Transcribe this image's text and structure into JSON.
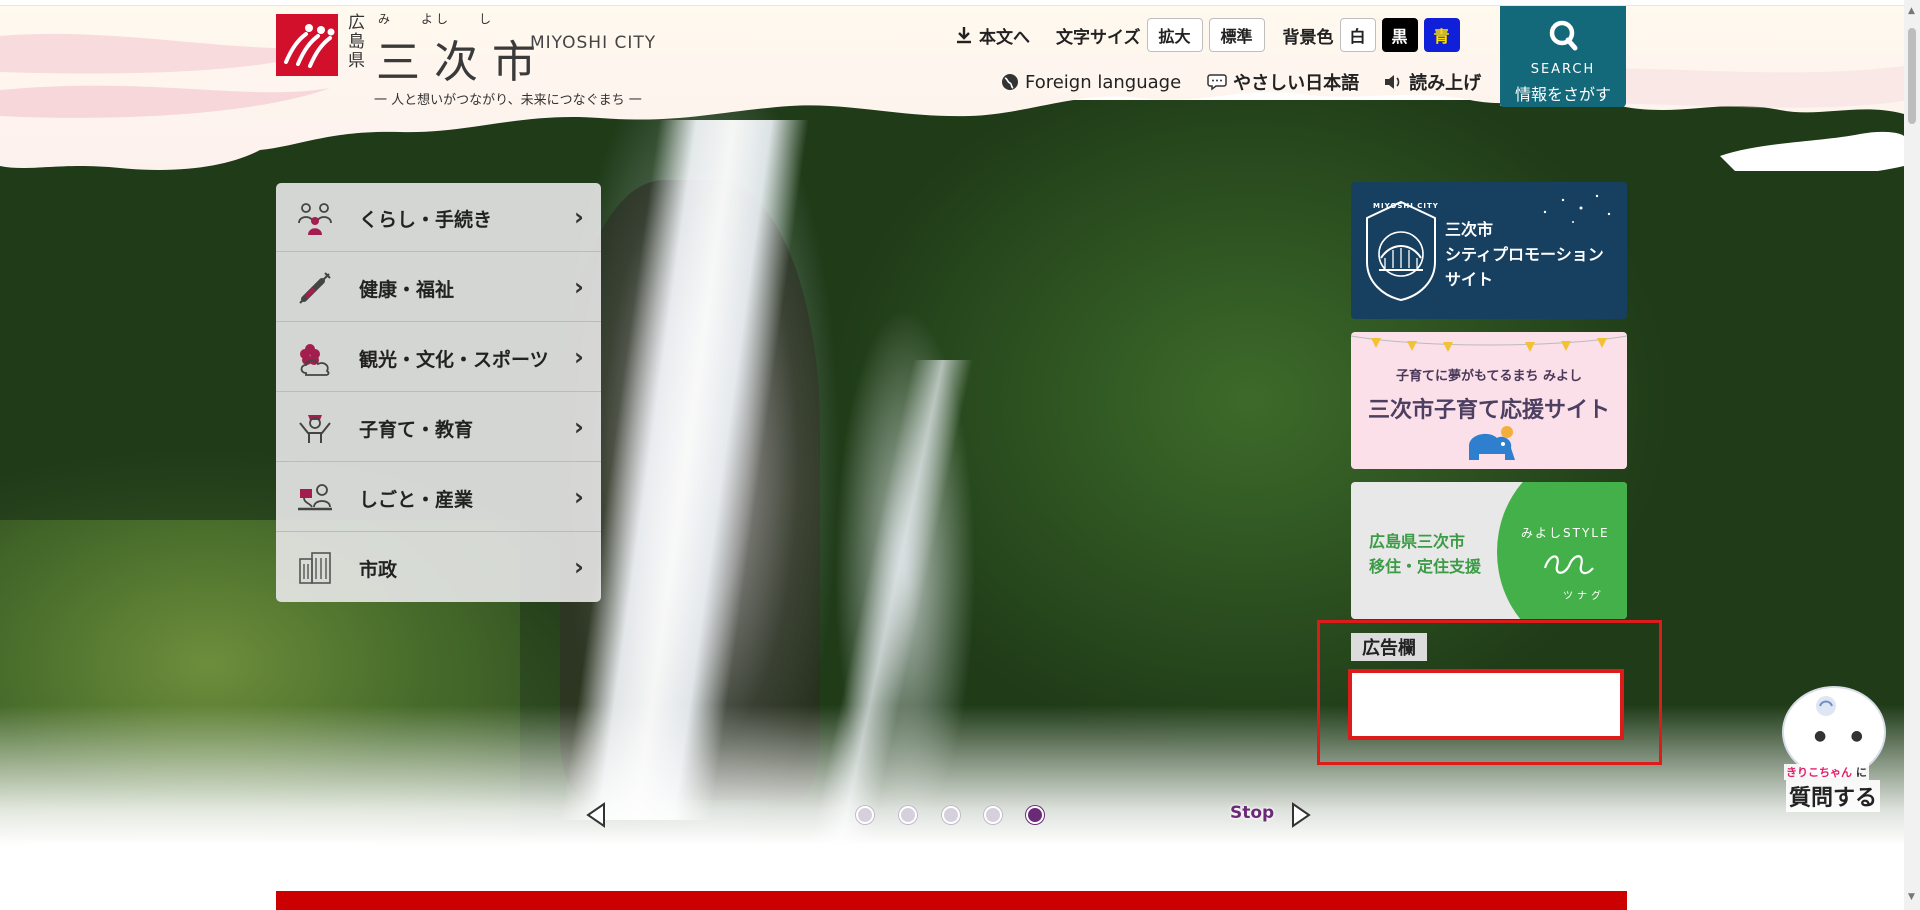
{
  "header": {
    "pref_chars": [
      "広",
      "島",
      "県"
    ],
    "ruby": [
      "み",
      "よし",
      "し"
    ],
    "city_name": "三次市",
    "city_en": "MIYOSHI CITY",
    "tagline": "一 人と想いがつながり、未来につなぐまち 一",
    "skip_to_content": "本文へ",
    "font_size_label": "文字サイズ",
    "font_size_large": "拡大",
    "font_size_standard": "標準",
    "bg_color_label": "背景色",
    "bg_white": "白",
    "bg_black": "黒",
    "bg_blue": "青",
    "foreign_language": "Foreign language",
    "easy_japanese": "やさしい日本語",
    "read_aloud": "読み上げ",
    "search_en": "SEARCH",
    "search_ja": "情報をさがす"
  },
  "nav": {
    "items": [
      {
        "label": "くらし・手続き",
        "icon": "people-icon"
      },
      {
        "label": "健康・福祉",
        "icon": "syringe-icon"
      },
      {
        "label": "観光・文化・スポーツ",
        "icon": "flower-cloud-icon"
      },
      {
        "label": "子育て・教育",
        "icon": "child-icon"
      },
      {
        "label": "しごと・産業",
        "icon": "work-icon"
      },
      {
        "label": "市政",
        "icon": "building-icon"
      }
    ]
  },
  "banners": {
    "promo": {
      "line1": "三次市",
      "line2": "シティプロモーション",
      "line3": "サイト",
      "badge": "MIYOSHI CITY"
    },
    "kosodate": {
      "line1": "子育てに夢がもてるまち みよし",
      "line2": "三次市子育て応援サイト"
    },
    "iju": {
      "line1": "広島県三次市",
      "line2": "移住・定住支援",
      "style": "みよしSTYLE",
      "sub": "ツナグ"
    }
  },
  "ad": {
    "label": "広告欄"
  },
  "slider": {
    "stop_label": "Stop",
    "dots": 5,
    "active_dot": 5
  },
  "chatbot": {
    "name": "きりこちゃん",
    "particle": "に",
    "action": "質問する"
  },
  "colors": {
    "brand_red": "#d2102b",
    "search_teal": "#13697a",
    "accent_purple": "#6a2a78",
    "highlight_red": "#dd1b1b"
  }
}
